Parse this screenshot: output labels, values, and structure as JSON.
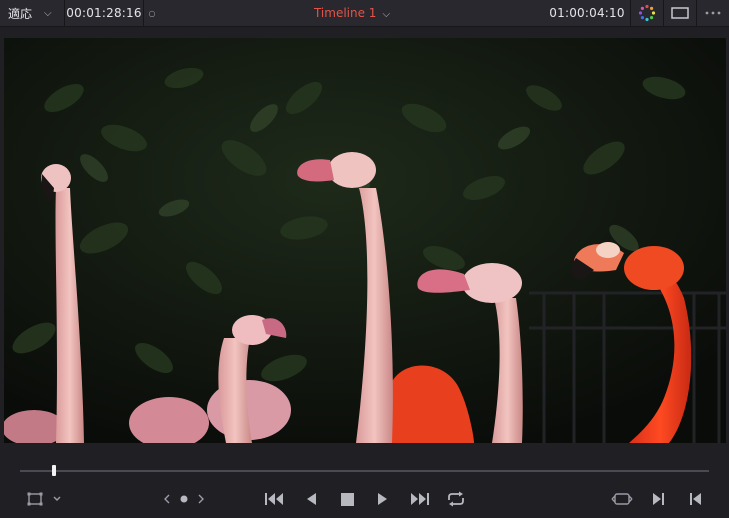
{
  "topbar": {
    "zoom_label": "適応",
    "source_timecode": "00:01:28:16",
    "timeline_title": "Timeline 1",
    "record_timecode": "01:00:04:10"
  },
  "colors": {
    "background": "#1f1f24",
    "toolbar": "#28282e",
    "timeline_title": "#e0544a",
    "timecode_text": "#e4e4e8",
    "icon": "#9c9ca6"
  },
  "viewer": {
    "content": "video frame — pink and orange flamingos in front of dark green foliage and a black railing"
  },
  "scrubber": {
    "playhead_position": 0.05
  },
  "icons": {
    "zoom_dropdown": "chevron-down-icon",
    "color_wheel": "color-wheel-icon",
    "viewer_mode": "viewer-mode-icon",
    "more": "more-options-icon",
    "safe_area": "safe-area-icon",
    "prev_next": "keyframe-nav-icon",
    "jump_first": "jump-to-first-frame-icon",
    "play_reverse": "play-reverse-icon",
    "stop": "stop-icon",
    "play": "play-icon",
    "jump_last": "jump-to-last-frame-icon",
    "loop": "loop-icon",
    "match_frame": "match-frame-icon",
    "next_edit": "next-edit-icon",
    "prev_edit": "previous-edit-icon"
  }
}
